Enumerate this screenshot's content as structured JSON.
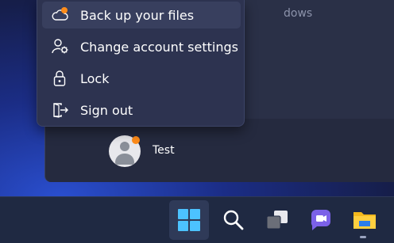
{
  "start_menu": {
    "search_hint": "dows"
  },
  "context_menu": {
    "items": [
      {
        "label": "Back up your files",
        "icon": "cloud-backup-icon",
        "badge_color": "#ff8c1a"
      },
      {
        "label": "Change account settings",
        "icon": "account-settings-icon"
      },
      {
        "label": "Lock",
        "icon": "lock-icon"
      },
      {
        "label": "Sign out",
        "icon": "sign-out-icon"
      }
    ]
  },
  "user": {
    "name": "Test",
    "icon": "user-avatar",
    "status_dot_color": "#ff8c1a"
  },
  "taskbar": {
    "items": [
      {
        "name": "start",
        "icon": "windows-start-icon",
        "active": true
      },
      {
        "name": "search",
        "icon": "search-icon"
      },
      {
        "name": "task-view",
        "icon": "task-view-icon"
      },
      {
        "name": "chat",
        "icon": "chat-icon"
      },
      {
        "name": "file-explorer",
        "icon": "folder-icon"
      }
    ]
  },
  "colors": {
    "accent": "#4cc2ff",
    "menu_background": "#2d3350",
    "badge": "#ff8c1a"
  }
}
